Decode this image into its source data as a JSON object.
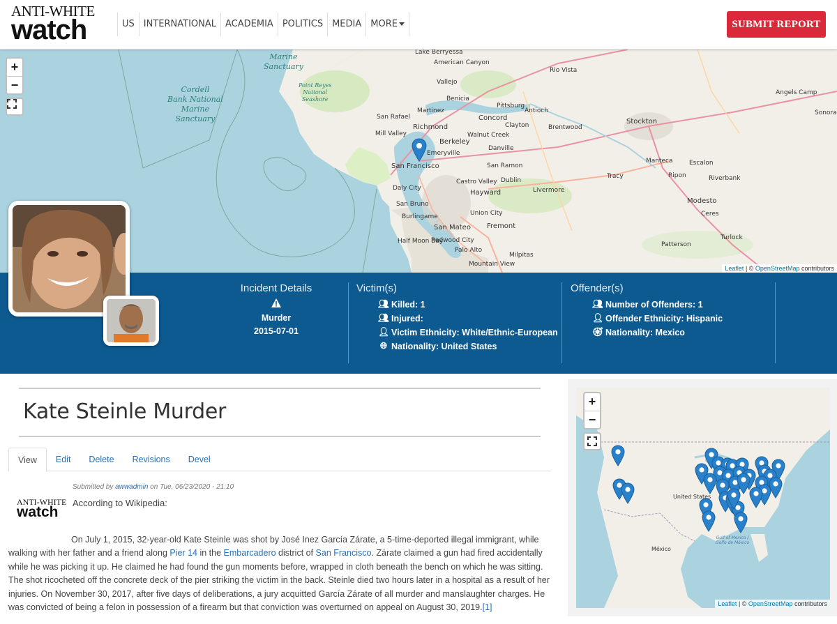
{
  "header": {
    "logo_top": "ANTI-WHITE",
    "logo_bottom": "watch",
    "nav": [
      {
        "label": "US"
      },
      {
        "label": "INTERNATIONAL"
      },
      {
        "label": "ACADEMIA"
      },
      {
        "label": "POLITICS"
      },
      {
        "label": "MEDIA"
      },
      {
        "label": "MORE"
      }
    ],
    "submit_label": "SUBMIT REPORT"
  },
  "top_map": {
    "attribution_leaflet": "Leaflet",
    "attribution_sep": " | © ",
    "attribution_osm": "OpenStreetMap",
    "attribution_tail": " contributors",
    "sanctuaries": [
      "Marine Sanctuary",
      "Cordell Bank National Marine Sanctuary",
      "Point Reyes National Seashore"
    ],
    "places": [
      "Lake Berryessa",
      "American Canyon",
      "Vallejo",
      "Rio Vista",
      "Angels Camp",
      "Sonora",
      "Benicia",
      "Martinez",
      "Pittsburg",
      "Antioch",
      "San Rafael",
      "Richmond",
      "Concord",
      "Stockton",
      "Walnut Creek",
      "Clayton",
      "Brentwood",
      "Mill Valley",
      "Berkeley",
      "Emeryville",
      "Danville",
      "San Francisco",
      "San Ramon",
      "Manteca",
      "Escalon",
      "Daly City",
      "Castro Valley",
      "Dublin",
      "Livermore",
      "Tracy",
      "Ripon",
      "Riverbank",
      "San Bruno",
      "Hayward",
      "Modesto",
      "Ceres",
      "Burlingame",
      "Union City",
      "Fremont",
      "San Mateo",
      "Turlock",
      "Half Moon Bay",
      "Redwood City",
      "Palo Alto",
      "Patterson",
      "Mountain View",
      "Milpitas"
    ]
  },
  "info": {
    "incident": {
      "title": "Incident Details",
      "type": "Murder",
      "date": "2015-07-01"
    },
    "victim": {
      "title": "Victim(s)",
      "killed": "Killed: 1",
      "injured": "Injured:",
      "ethnicity": "Victim Ethnicity: White/Ethnic-European",
      "nationality": "Nationality: United States"
    },
    "offender": {
      "title": "Offender(s)",
      "number": "Number of Offenders: 1",
      "ethnicity": "Offender Ethnicity: Hispanic",
      "nationality": "Nationality: Mexico"
    }
  },
  "article": {
    "title": "Kate Steinle Murder",
    "tabs": [
      {
        "label": "View"
      },
      {
        "label": "Edit"
      },
      {
        "label": "Delete"
      },
      {
        "label": "Revisions"
      },
      {
        "label": "Devel"
      }
    ],
    "submitted_prefix": "Submitted by ",
    "submitted_user": "awwadmin",
    "submitted_suffix": " on Tue, 06/23/2020 - 21:10",
    "logo_top": "ANTI-WHITE",
    "logo_bottom": "watch",
    "according": "According to Wikipedia:",
    "p1": "On July 1, 2015, 32-year-old Kate Steinle was shot by José Inez García Zárate, a 5-time-deported illegal immigrant, while walking with her father and a friend along ",
    "link_pier": "Pier 14",
    "p2": " in the ",
    "link_embarcadero": "Embarcadero",
    "p3": " district of ",
    "link_sf": "San Francisco",
    "p4": ". Zárate claimed a gun had fired accidentally while he was picking it up. He claimed he had found the gun moments before, wrapped in cloth beneath the bench on which he was sitting. The shot ricocheted off the concrete deck of the pier striking the victim in the back. Steinle died two hours later in a hospital as a result of her injuries. On November 30, 2017, after five days of deliberations, a jury acquitted García Zárate of all murder and manslaughter charges. He was convicted of being a felon in possession of a firearm but that conviction was overturned on appeal on August 30, 2019.",
    "ref": "[1]"
  },
  "side_map": {
    "labels": [
      "United States",
      "México",
      "Gulf of Mexico / Golfo de México"
    ],
    "attribution_leaflet": "Leaflet",
    "attribution_sep": " | © ",
    "attribution_osm": "OpenStreetMap",
    "attribution_tail": " contributors"
  },
  "colors": {
    "accent": "#d9293b",
    "infobar": "#0d5a91",
    "link": "#2a6fb0",
    "pin": "#2a81cb"
  }
}
